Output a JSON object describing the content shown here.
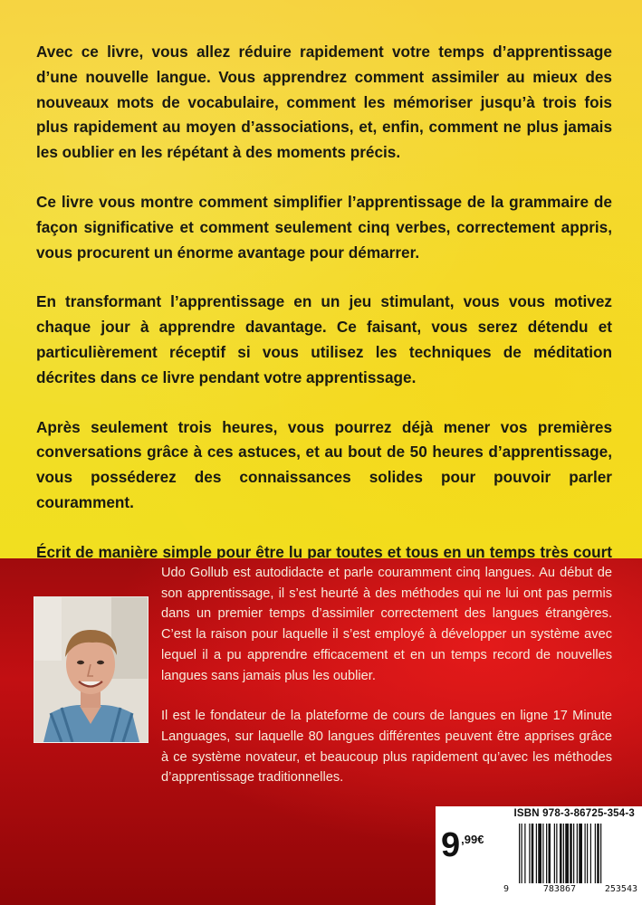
{
  "description": {
    "paragraphs": [
      "Avec ce livre, vous allez réduire rapidement votre temps d’apprentissage d’une nouvelle langue. Vous apprendrez comment assimiler au mieux des nouveaux mots de vocabulaire, comment les mémoriser jusqu’à trois fois plus rapidement au moyen d’associations, et, enfin, comment ne plus jamais les oublier en les répétant à des moments précis.",
      "Ce livre vous montre comment simplifier l’apprentissage de la grammaire de façon significative et comment seulement cinq verbes, correctement appris, vous procurent un énorme avantage pour démarrer.",
      "En transformant l’apprentissage en un jeu stimulant, vous vous motivez chaque jour à apprendre davantage. Ce faisant, vous serez détendu et particulièrement réceptif si vous utilisez les techniques de méditation décrites dans ce livre pendant votre apprentissage.",
      "Après seulement trois heures, vous pourrez déjà mener vos premières conversations grâce à ces astuces, et au bout de 50 heures d’apprentissage, vous posséderez des connaissances solides pour pouvoir parler couramment.",
      "Écrit de manière simple pour être lu par toutes et tous en un temps très court pour pouvoir appliquer son contenu immédiatement !"
    ]
  },
  "author": {
    "bio": [
      "Udo Gollub est autodidacte et parle couramment cinq langues. Au début de son apprentissage, il s’est heurté à des méthodes qui ne lui ont pas permis dans un premier temps d’assimiler correctement des langues étrangères. C’est la raison pour laquelle il s’est employé à développer un système avec lequel il a pu apprendre efficacement et en un temps record de nouvelles langues sans jamais plus les oublier.",
      "Il est le fondateur de la plateforme de cours de langues en ligne 17 Minute Languages, sur laquelle 80 langues différentes peuvent être apprises grâce à ce système novateur, et beaucoup plus rapidement qu’avec les méthodes d’apprentissage traditionnelles."
    ]
  },
  "barcode": {
    "isbn": "ISBN 978-3-86725-354-3",
    "price_integer": "9",
    "price_decimal": ",99€",
    "digits": [
      "9",
      "783867",
      "253543"
    ]
  },
  "colors": {
    "top_background": "#f3dc2e",
    "bottom_background": "#b50d10",
    "body_text": "#1a1a12",
    "bio_text": "#f6ecdc"
  }
}
